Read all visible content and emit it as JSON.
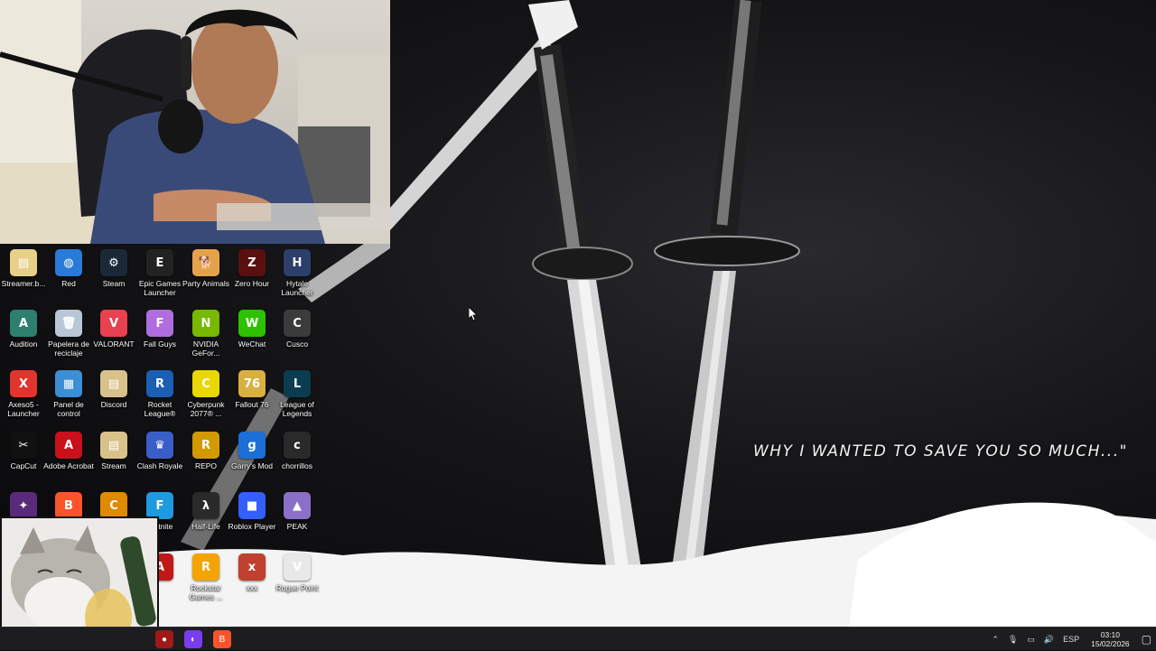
{
  "wallpaper": {
    "quote": "WHY I WANTED TO SAVE YOU SO MUCH...\""
  },
  "desktop_icons": [
    {
      "label": "Streamer.b...",
      "color": "#e8d089",
      "glyph": "▤"
    },
    {
      "label": "Red",
      "color": "#2a7ad8",
      "glyph": "◍"
    },
    {
      "label": "Steam",
      "color": "#1b2838",
      "glyph": "⚙"
    },
    {
      "label": "Epic Games Launcher",
      "color": "#222222",
      "glyph": "E"
    },
    {
      "label": "Party Animals",
      "color": "#e6a24a",
      "glyph": "🐕"
    },
    {
      "label": "Zero Hour",
      "color": "#5b1010",
      "glyph": "Z"
    },
    {
      "label": "Hytale Launcher",
      "color": "#2c3e6a",
      "glyph": "H"
    },
    {
      "label": "Audition",
      "color": "#2f7f6f",
      "glyph": "A"
    },
    {
      "label": "Papelera de reciclaje",
      "color": "#b9c6d6",
      "glyph": "🗑"
    },
    {
      "label": "VALORANT",
      "color": "#e9414f",
      "glyph": "V"
    },
    {
      "label": "Fall Guys",
      "color": "#b06de0",
      "glyph": "F"
    },
    {
      "label": "NVIDIA GeFor...",
      "color": "#76b900",
      "glyph": "N"
    },
    {
      "label": "WeChat",
      "color": "#2dc100",
      "glyph": "W"
    },
    {
      "label": "Cusco",
      "color": "#3b3b3b",
      "glyph": "C"
    },
    {
      "label": "Axeso5 - Launcher",
      "color": "#e0342c",
      "glyph": "X"
    },
    {
      "label": "Panel de control",
      "color": "#3a8fd6",
      "glyph": "▦"
    },
    {
      "label": "Discord",
      "color": "#d8c28a",
      "glyph": "▤"
    },
    {
      "label": "Rocket League®",
      "color": "#1a5fb4",
      "glyph": "R"
    },
    {
      "label": "Cyberpunk 2077® ...",
      "color": "#e8d800",
      "glyph": "C"
    },
    {
      "label": "Fallout 76",
      "color": "#d7b040",
      "glyph": "76"
    },
    {
      "label": "League of Legends",
      "color": "#0b3c50",
      "glyph": "L"
    },
    {
      "label": "CapCut",
      "color": "#111111",
      "glyph": "✂"
    },
    {
      "label": "Adobe Acrobat",
      "color": "#c9101b",
      "glyph": "A"
    },
    {
      "label": "Stream",
      "color": "#d8c28a",
      "glyph": "▤"
    },
    {
      "label": "Clash Royale",
      "color": "#3a5ec8",
      "glyph": "♛"
    },
    {
      "label": "REPO",
      "color": "#d19a00",
      "glyph": "R"
    },
    {
      "label": "Garry's Mod",
      "color": "#1b6fd6",
      "glyph": "g"
    },
    {
      "label": "chorrillos",
      "color": "#2a2a2a",
      "glyph": "c"
    },
    {
      "label": "",
      "color": "#5a2a7a",
      "glyph": "✦"
    },
    {
      "label": "",
      "color": "#fb542b",
      "glyph": "B"
    },
    {
      "label": "",
      "color": "#e08a00",
      "glyph": "C"
    },
    {
      "label": "Fortnite",
      "color": "#1e9be0",
      "glyph": "F"
    },
    {
      "label": "Half-Life",
      "color": "#2a2a2a",
      "glyph": "λ"
    },
    {
      "label": "Roblox Player",
      "color": "#335fff",
      "glyph": "■"
    },
    {
      "label": "PEAK",
      "color": "#8a70c9",
      "glyph": "▲"
    },
    {
      "label": "",
      "color": "",
      "glyph": ""
    },
    {
      "label": "",
      "color": "",
      "glyph": ""
    },
    {
      "label": "",
      "color": "",
      "glyph": ""
    },
    {
      "label": "",
      "color": "#c01818",
      "glyph": "A"
    },
    {
      "label": "Rockstar Games ...",
      "color": "#f3a400",
      "glyph": "R"
    },
    {
      "label": "xxx",
      "color": "#c04030",
      "glyph": "x"
    },
    {
      "label": "Rogue Point",
      "color": "#e8e8e8",
      "glyph": "V"
    }
  ],
  "taskbar": {
    "pinned": [
      {
        "name": "app-a",
        "color": "#a01818",
        "glyph": "●"
      },
      {
        "name": "messenger",
        "color": "#7a3cf0",
        "glyph": "◐"
      },
      {
        "name": "brave",
        "color": "#fb542b",
        "glyph": "B"
      }
    ],
    "language": "ESP",
    "time": "03:10",
    "date": "15/02/2026"
  }
}
